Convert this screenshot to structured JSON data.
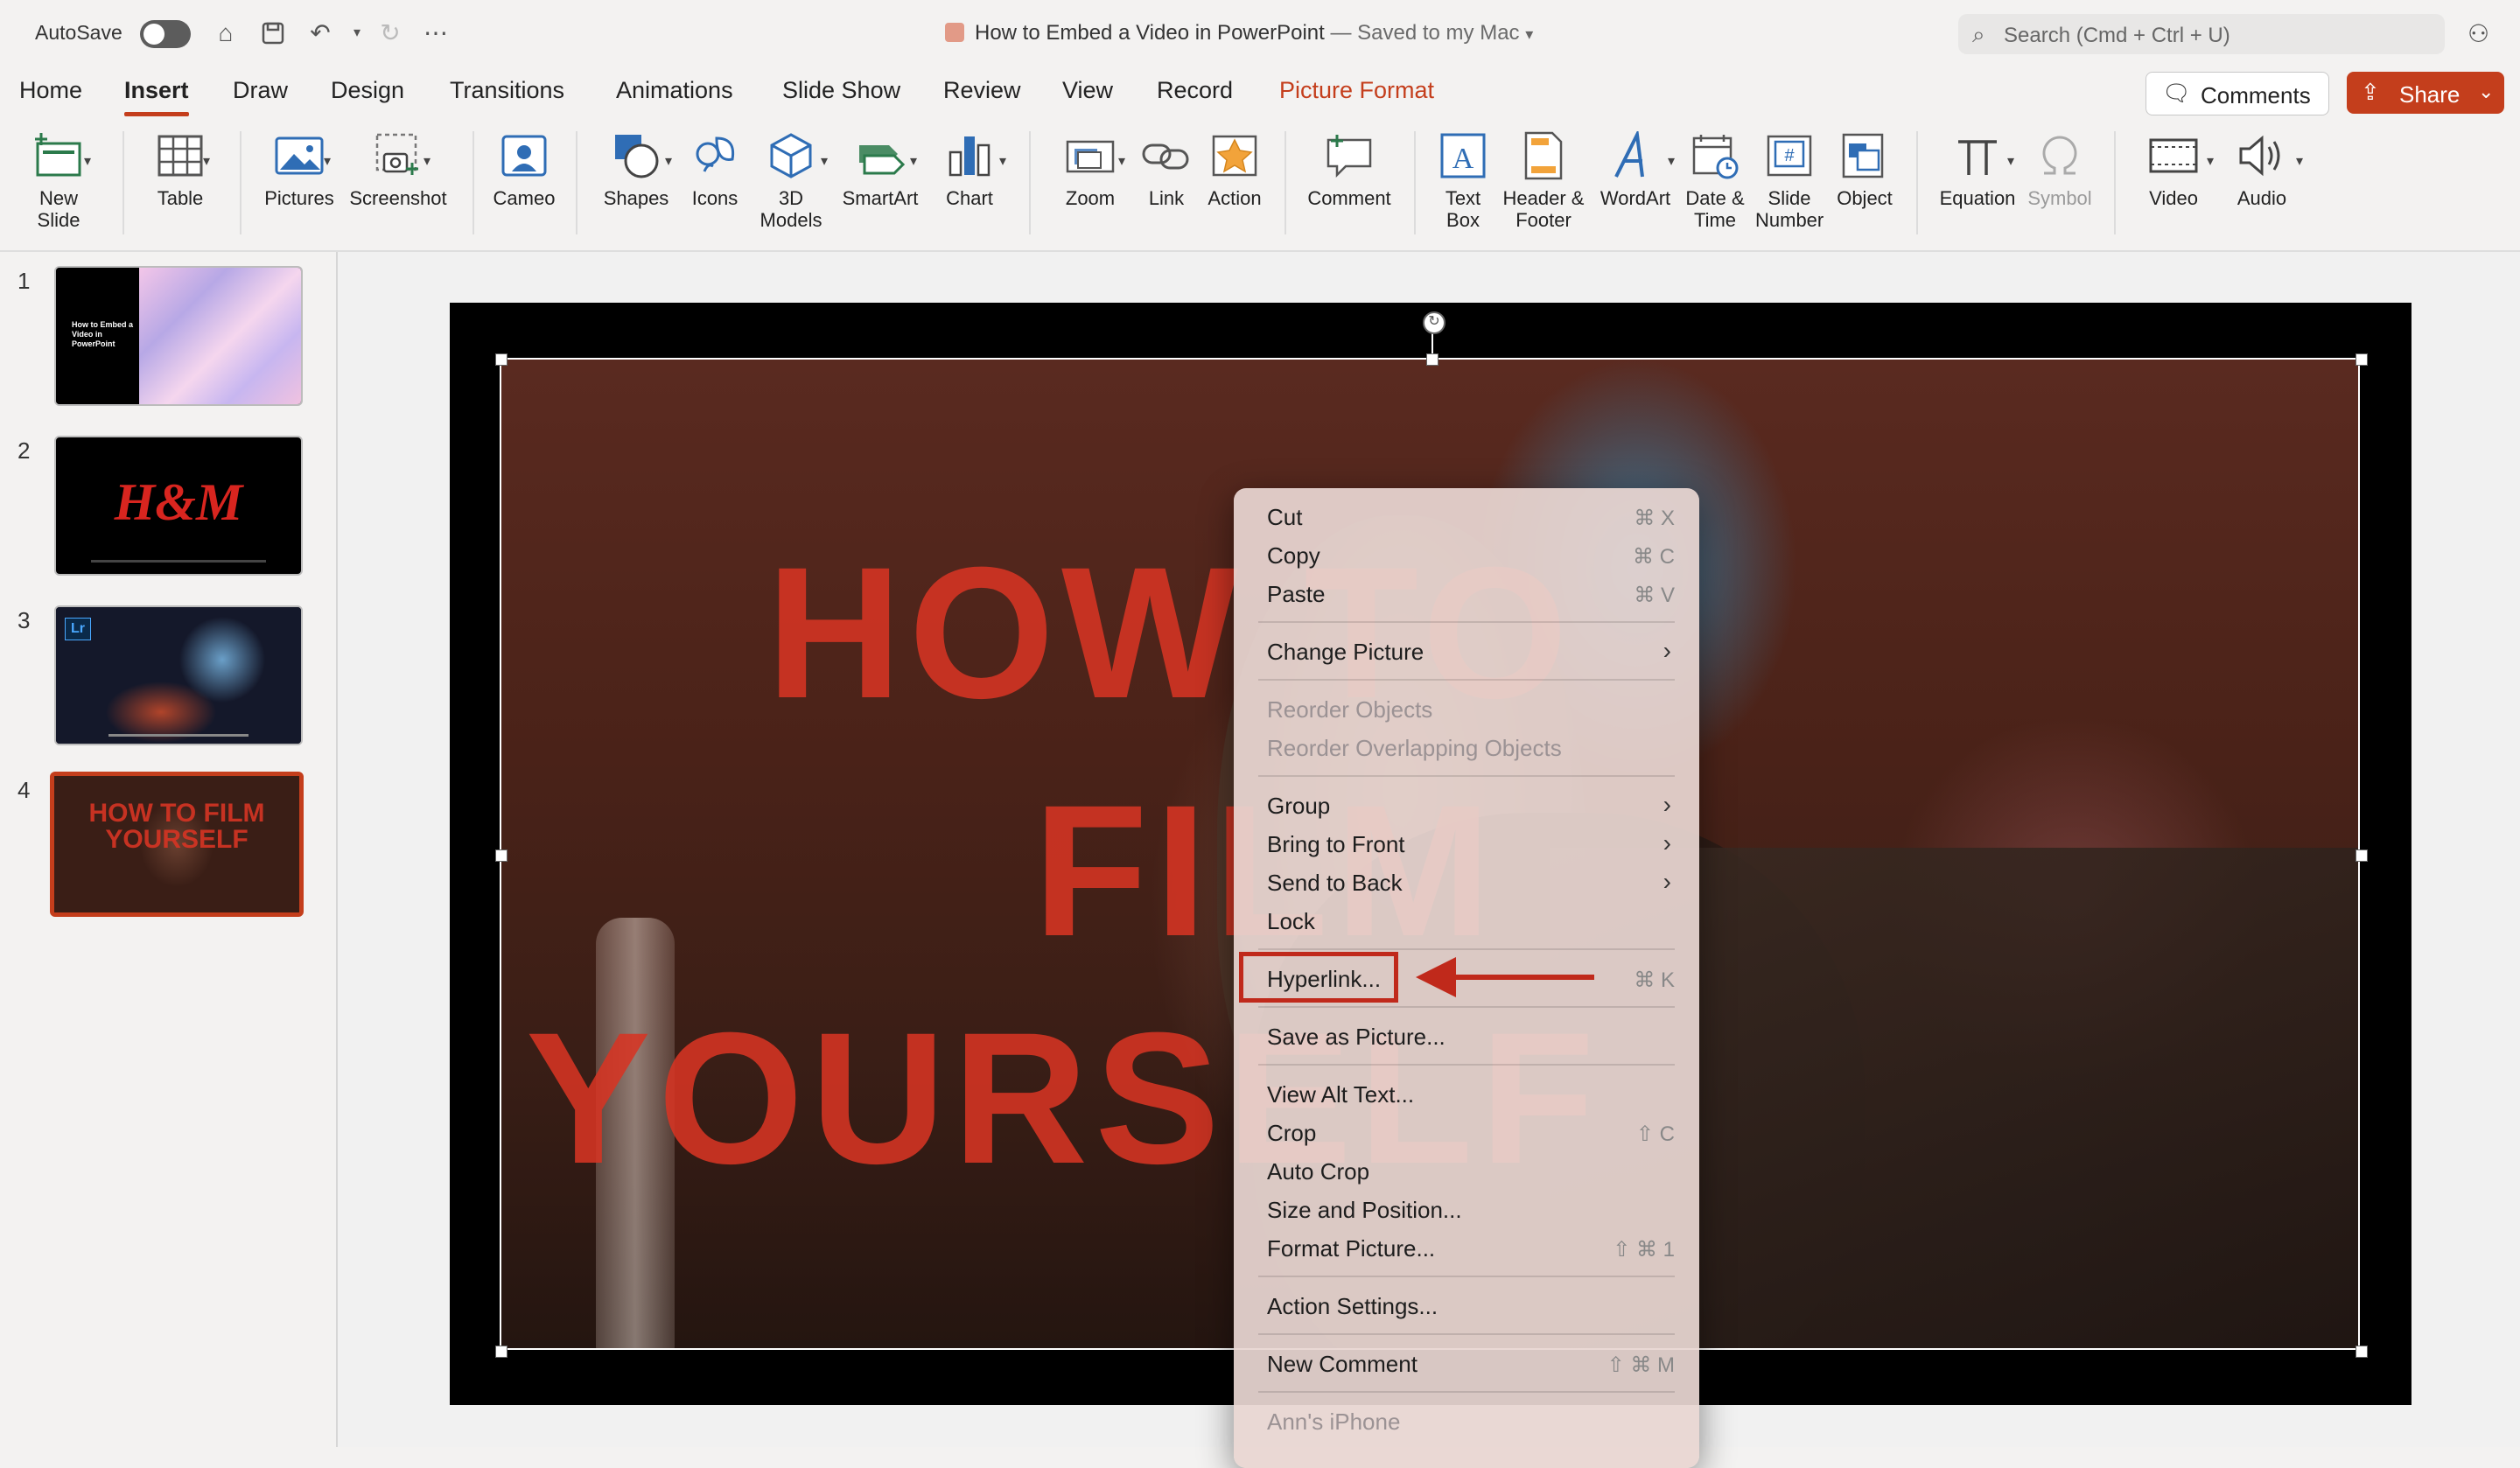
{
  "titlebar": {
    "autosave_label": "AutoSave",
    "doc_title": "How to Embed a Video in PowerPoint",
    "saved_status": "— Saved to my Mac",
    "search_placeholder": "Search (Cmd + Ctrl + U)"
  },
  "tabs": [
    "Home",
    "Insert",
    "Draw",
    "Design",
    "Transitions",
    "Animations",
    "Slide Show",
    "Review",
    "View",
    "Record",
    "Picture Format"
  ],
  "active_tab": "Insert",
  "actions": {
    "comments_label": "Comments",
    "share_label": "Share"
  },
  "ribbon": {
    "new_slide": "New\nSlide",
    "table": "Table",
    "pictures": "Pictures",
    "screenshot": "Screenshot",
    "cameo": "Cameo",
    "shapes": "Shapes",
    "icons": "Icons",
    "models3d": "3D\nModels",
    "smartart": "SmartArt",
    "chart": "Chart",
    "zoom": "Zoom",
    "link": "Link",
    "action": "Action",
    "comment": "Comment",
    "text_box": "Text\nBox",
    "header_footer": "Header &\nFooter",
    "wordart": "WordArt",
    "date_time": "Date &\nTime",
    "slide_number": "Slide\nNumber",
    "object": "Object",
    "equation": "Equation",
    "symbol": "Symbol",
    "video": "Video",
    "audio": "Audio"
  },
  "slides": [
    {
      "num": "1",
      "caption": "How to Embed a Video in PowerPoint"
    },
    {
      "num": "2",
      "caption": "H&M"
    },
    {
      "num": "3",
      "caption": "Lr"
    },
    {
      "num": "4",
      "caption": "HOW TO FILM YOURSELF"
    }
  ],
  "slide_text": {
    "line1": "HOW TO",
    "line2": "FILM",
    "line3": "YOURSELF"
  },
  "context_menu": {
    "cut": {
      "label": "Cut",
      "shortcut": "⌘ X"
    },
    "copy": {
      "label": "Copy",
      "shortcut": "⌘ C"
    },
    "paste": {
      "label": "Paste",
      "shortcut": "⌘ V"
    },
    "change_picture": {
      "label": "Change Picture"
    },
    "reorder_objects": {
      "label": "Reorder Objects"
    },
    "reorder_overlapping": {
      "label": "Reorder Overlapping Objects"
    },
    "group": {
      "label": "Group"
    },
    "bring_to_front": {
      "label": "Bring to Front"
    },
    "send_to_back": {
      "label": "Send to Back"
    },
    "lock": {
      "label": "Lock"
    },
    "hyperlink": {
      "label": "Hyperlink...",
      "shortcut": "⌘ K"
    },
    "save_as_picture": {
      "label": "Save as Picture..."
    },
    "view_alt_text": {
      "label": "View Alt Text..."
    },
    "crop": {
      "label": "Crop",
      "shortcut": "⇧ C"
    },
    "auto_crop": {
      "label": "Auto Crop"
    },
    "size_position": {
      "label": "Size and Position..."
    },
    "format_picture": {
      "label": "Format Picture...",
      "shortcut": "⇧ ⌘ 1"
    },
    "action_settings": {
      "label": "Action Settings..."
    },
    "new_comment": {
      "label": "New Comment",
      "shortcut": "⇧ ⌘ M"
    },
    "device": {
      "label": "Ann's iPhone"
    }
  },
  "colors": {
    "accent": "#c43e1c",
    "annotation": "#c0291b",
    "slide_text": "#d63423"
  }
}
